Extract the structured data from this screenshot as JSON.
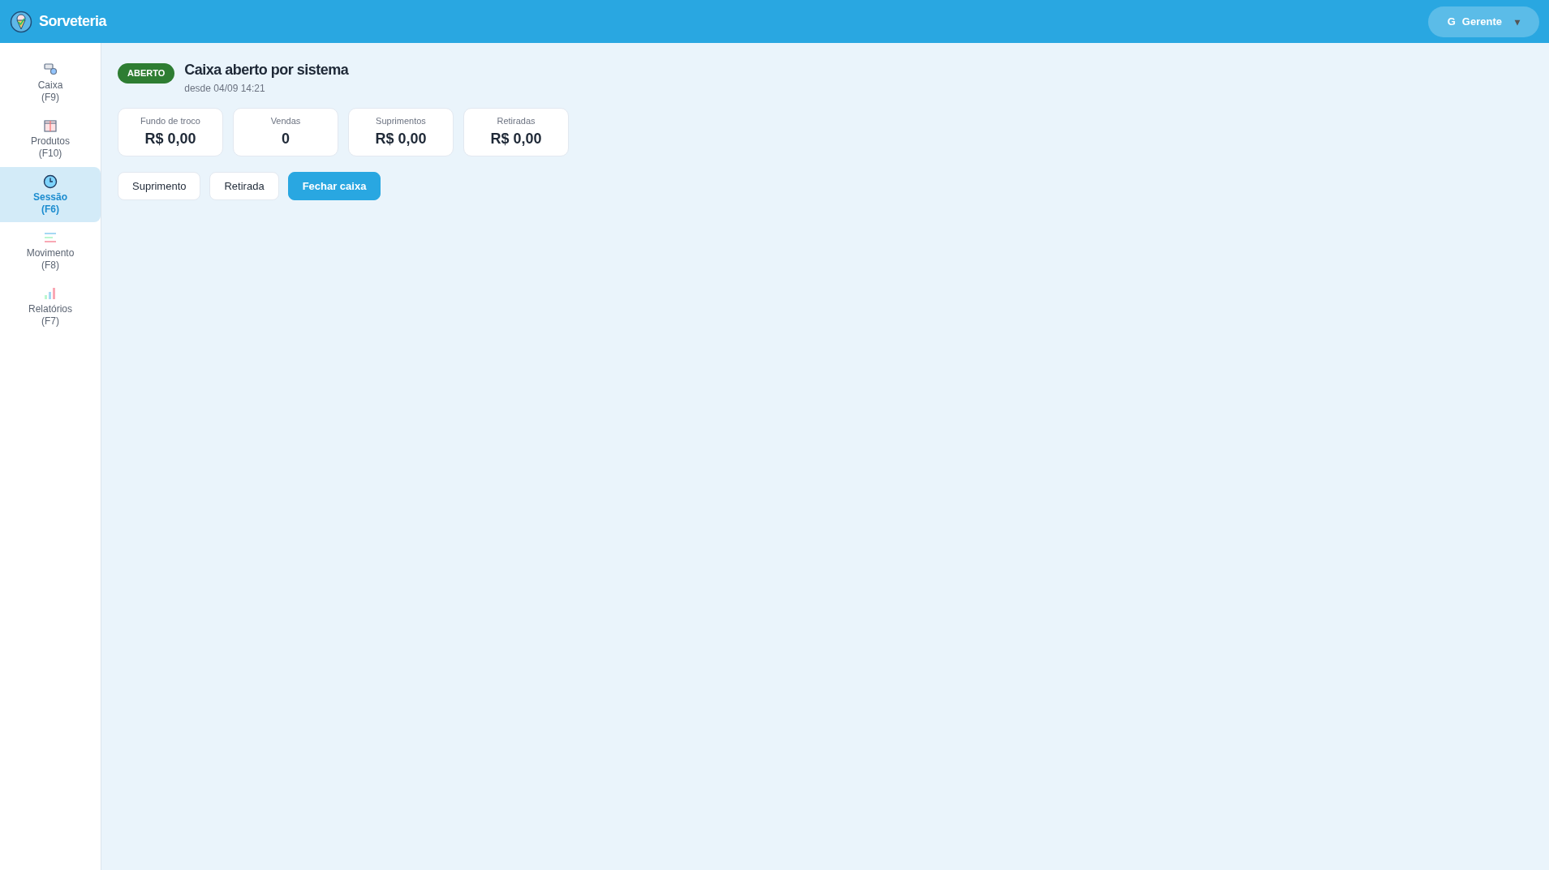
{
  "app": {
    "title": "Sorveteria"
  },
  "user_menu": {
    "avatar": "G",
    "name": "Gerente",
    "caret": "▾"
  },
  "sidebar": {
    "items": [
      {
        "label": "Caixa",
        "shortcut": "(F9)",
        "kind": "register",
        "selected": false
      },
      {
        "label": "Produtos",
        "shortcut": "(F10)",
        "kind": "box",
        "selected": false
      },
      {
        "label": "Sessão",
        "shortcut": "(F6)",
        "kind": "clock",
        "selected": true
      },
      {
        "label": "Movimento",
        "shortcut": "(F8)",
        "kind": "lines",
        "selected": false
      },
      {
        "label": "Relatórios",
        "shortcut": "(F7)",
        "kind": "chart",
        "selected": false
      }
    ]
  },
  "session": {
    "status": "ABERTO",
    "title": "Caixa aberto por sistema",
    "since": "desde 04/09 14:21"
  },
  "stats": [
    {
      "label": "Fundo de troco",
      "value": "R$ 0,00"
    },
    {
      "label": "Vendas",
      "value": "0"
    },
    {
      "label": "Suprimentos",
      "value": "R$ 0,00"
    },
    {
      "label": "Retiradas",
      "value": "R$ 0,00"
    }
  ],
  "actions": [
    {
      "label": "Suprimento",
      "kind": "secondary"
    },
    {
      "label": "Retirada",
      "kind": "secondary"
    },
    {
      "label": "Fechar caixa",
      "kind": "primary"
    }
  ]
}
